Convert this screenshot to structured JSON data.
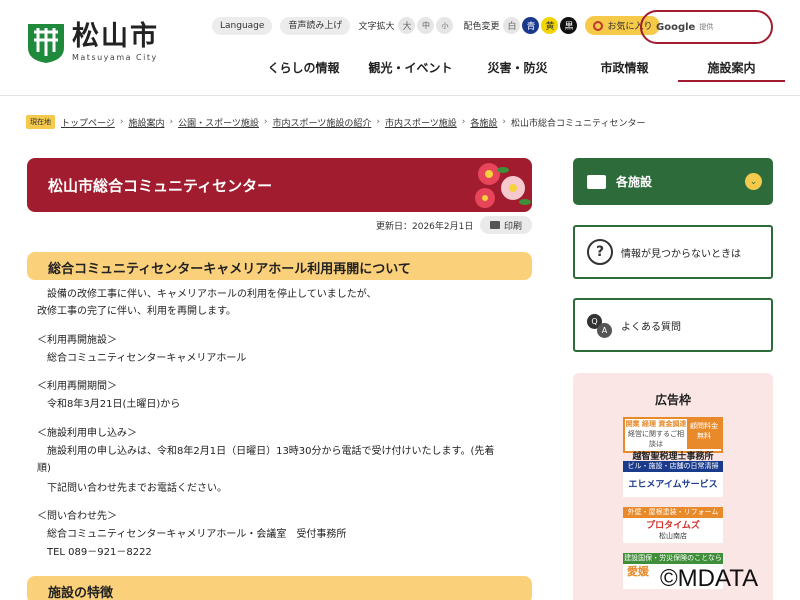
{
  "header": {
    "logo_name": "松山市",
    "logo_sub": "Matsuyama City",
    "language": "Language",
    "speech": "音声読み上げ",
    "text_size_label": "文字拡大",
    "sizes": [
      "大",
      "中",
      "小"
    ],
    "color_label": "配色変更",
    "colors": [
      "白",
      "青",
      "黄",
      "黒"
    ],
    "favorite": "お気に入り",
    "search_brand": "Google",
    "search_provided": "提供"
  },
  "nav": [
    "くらしの情報",
    "観光・イベント",
    "災害・防災",
    "市政情報",
    "施設案内"
  ],
  "breadcrumb": {
    "here": "現在地",
    "links": [
      "トップページ",
      "施設案内",
      "公園・スポーツ施設",
      "市内スポーツ施設の紹介",
      "市内スポーツ施設",
      "各施設"
    ],
    "current": "松山市総合コミュニティセンター"
  },
  "page": {
    "title": "松山市総合コミュニティセンター",
    "updated": "更新日：2026年2月1日",
    "print": "印刷"
  },
  "section1": {
    "heading": "総合コミュニティセンターキャメリアホール利用再開について",
    "p1a": "設備の改修工事に伴い、キャメリアホールの利用を停止していましたが、",
    "p1b": "改修工事の完了に伴い、利用を再開します。",
    "h_facility": "＜利用再開施設＞",
    "facility": "総合コミュニティセンターキャメリアホール",
    "h_date": "＜利用再開期間＞",
    "date": "令和8年3月21日(土曜日)から",
    "h_apply": "＜施設利用申し込み＞",
    "apply_a": "施設利用の申し込みは、令和8年2月1日（日曜日）13時30分から電話で受け付けいたします。(先着",
    "apply_b": "順)",
    "apply_c": "下記問い合わせ先までお電話ください。",
    "h_contact": "＜問い合わせ先＞",
    "contact": "総合コミュニティセンターキャメリアホール・会議室　受付事務所",
    "tel": "TEL 089－921－8222"
  },
  "section2": {
    "heading": "施設の特徴"
  },
  "sidebar": {
    "facilities": "各施設",
    "not_found": "情報が見つからないときは",
    "faq": "よくある質問"
  },
  "ads": {
    "title": "広告枠",
    "ad1_top": "開業 経理 資金調達",
    "ad1_top2": "経営に関するご相談は",
    "ad1_badge": "顧問料金 無料",
    "ad1_name": "越智聖税理士事務所",
    "ad2_top": "ビル・施設・店舗の日常清掃",
    "ad2_name": "エヒメアイムサービス",
    "ad3_top": "外壁・屋根塗装・リフォーム",
    "ad3_name": "プロタイムズ",
    "ad3_sub": "松山南店",
    "ad4_top": "建設国保・労災保険のことなら",
    "ad4_name": "愛媛"
  },
  "watermark": "©MDATA"
}
